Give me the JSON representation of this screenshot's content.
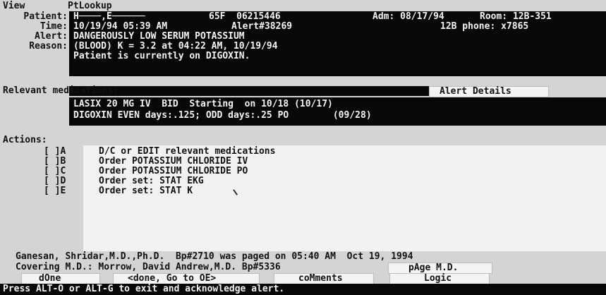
{
  "menu": {
    "view": "View",
    "ptlookup": "PtLookup"
  },
  "header": {
    "patient_label": "Patient:",
    "patient_name": "H────,E──────",
    "patient_demo": "65F  06215446",
    "adm": "Adm: 08/17/94",
    "room": "Room: 12B-351",
    "time_label": "Time:",
    "time_value": "10/19/94 05:39 AM",
    "alert_no": "Alert#38269",
    "phone": "12B phone: x7865",
    "alert_label": "Alert:",
    "alert_value": "DANGEROUSLY LOW SERUM POTASSIUM",
    "reason_label": "Reason:",
    "reason_line1": "(BLOOD) K = 3.2 at 04:22 AM, 10/19/94",
    "reason_line2": "Patient is currently on DIGOXIN."
  },
  "medications": {
    "label": "Relevant medications:",
    "alert_details": "Alert Details",
    "lines": [
      "LASIX 20 MG IV  BID  Starting  on 10/18 (10/17)",
      "DIGOXIN EVEN days:.125; ODD days:.25 PO        (09/28)"
    ]
  },
  "actions": {
    "label": "Actions:",
    "items": [
      {
        "check": "[ ]A",
        "text": "D/C or EDIT relevant medications"
      },
      {
        "check": "[ ]B",
        "text": "Order POTASSIUM CHLORIDE IV"
      },
      {
        "check": "[ ]C",
        "text": "Order POTASSIUM CHLORIDE PO"
      },
      {
        "check": "[ ]D",
        "text": "Order set: STAT EKG"
      },
      {
        "check": "[ ]E",
        "text": "Order set: STAT K"
      }
    ]
  },
  "footer": {
    "paged_line": "Ganesan, Shridar,M.D.,Ph.D.  Bp#2710 was paged on 05:40 AM  Oct 19, 1994",
    "covering_line": "Covering M.D.: Morrow, David Andrew,M.D. Bp#5336",
    "page_md": "pAge M.D.",
    "done": "dOne",
    "done_go": "<done, Go to OE>",
    "comments": "coMments",
    "logic": "Logic",
    "status": "Press ALT-O or ALT-G to exit and acknowledge alert."
  },
  "colors": {
    "background": "#d4d4d4",
    "bar": "#080808",
    "text_light": "#f4f4f4",
    "text_dark": "#111111"
  }
}
